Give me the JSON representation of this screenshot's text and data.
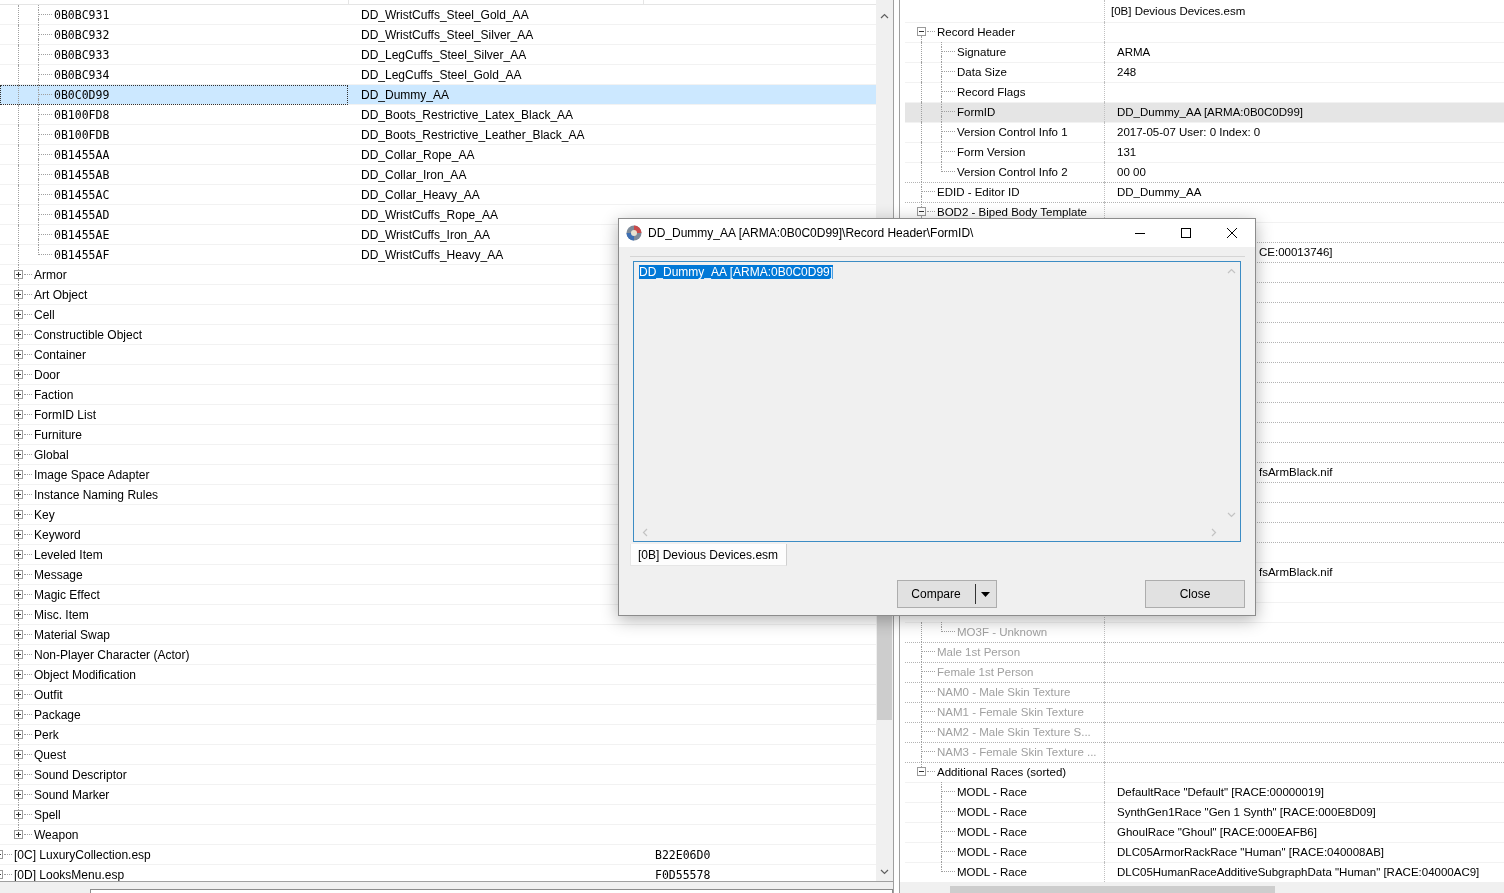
{
  "record_list": {
    "tree": [
      {
        "kind": "continued",
        "children": [
          {
            "kind": "continued",
            "children": [
              {
                "kind": "record",
                "label": "0B0BC931",
                "column_2": "DD_WristCuffs_Steel_Gold_AA",
                "selected": false
              },
              {
                "kind": "record",
                "label": "0B0BC932",
                "column_2": "DD_WristCuffs_Steel_Silver_AA",
                "selected": false
              },
              {
                "kind": "record",
                "label": "0B0BC933",
                "column_2": "DD_LegCuffs_Steel_Silver_AA",
                "selected": false
              },
              {
                "kind": "record",
                "label": "0B0BC934",
                "column_2": "DD_LegCuffs_Steel_Gold_AA",
                "selected": false
              },
              {
                "kind": "record",
                "label": "0B0C0D99",
                "column_2": "DD_Dummy_AA",
                "selected": true
              },
              {
                "kind": "record",
                "label": "0B100FD8",
                "column_2": "DD_Boots_Restrictive_Latex_Black_AA",
                "selected": false
              },
              {
                "kind": "record",
                "label": "0B100FDB",
                "column_2": "DD_Boots_Restrictive_Leather_Black_AA",
                "selected": false
              },
              {
                "kind": "record",
                "label": "0B1455AA",
                "column_2": "DD_Collar_Rope_AA",
                "selected": false
              },
              {
                "kind": "record",
                "label": "0B1455AB",
                "column_2": "DD_Collar_Iron_AA",
                "selected": false
              },
              {
                "kind": "record",
                "label": "0B1455AC",
                "column_2": "DD_Collar_Heavy_AA",
                "selected": false
              },
              {
                "kind": "record",
                "label": "0B1455AD",
                "column_2": "DD_WristCuffs_Rope_AA",
                "selected": false
              },
              {
                "kind": "record",
                "label": "0B1455AE",
                "column_2": "DD_WristCuffs_Iron_AA",
                "selected": false
              },
              {
                "kind": "record",
                "label": "0B1455AF",
                "column_2": "DD_WristCuffs_Heavy_AA",
                "selected": false
              }
            ]
          },
          {
            "kind": "group",
            "label": "Armor",
            "expanded": false,
            "selected": false
          },
          {
            "kind": "group",
            "label": "Art Object",
            "expanded": false,
            "selected": false
          },
          {
            "kind": "group",
            "label": "Cell",
            "expanded": false,
            "selected": false
          },
          {
            "kind": "group",
            "label": "Constructible Object",
            "expanded": false,
            "selected": false
          },
          {
            "kind": "group",
            "label": "Container",
            "expanded": false,
            "selected": false
          },
          {
            "kind": "group",
            "label": "Door",
            "expanded": false,
            "selected": false
          },
          {
            "kind": "group",
            "label": "Faction",
            "expanded": false,
            "selected": false
          },
          {
            "kind": "group",
            "label": "FormID List",
            "expanded": false,
            "selected": false
          },
          {
            "kind": "group",
            "label": "Furniture",
            "expanded": false,
            "selected": false
          },
          {
            "kind": "group",
            "label": "Global",
            "expanded": false,
            "selected": false
          },
          {
            "kind": "group",
            "label": "Image Space Adapter",
            "expanded": false,
            "selected": false
          },
          {
            "kind": "group",
            "label": "Instance Naming Rules",
            "expanded": false,
            "selected": false
          },
          {
            "kind": "group",
            "label": "Key",
            "expanded": false,
            "selected": false
          },
          {
            "kind": "group",
            "label": "Keyword",
            "expanded": false,
            "selected": false
          },
          {
            "kind": "group",
            "label": "Leveled Item",
            "expanded": false,
            "selected": false
          },
          {
            "kind": "group",
            "label": "Message",
            "expanded": false,
            "selected": false
          },
          {
            "kind": "group",
            "label": "Magic Effect",
            "expanded": false,
            "selected": false
          },
          {
            "kind": "group",
            "label": "Misc. Item",
            "expanded": false,
            "selected": false
          },
          {
            "kind": "group",
            "label": "Material Swap",
            "expanded": false,
            "selected": false
          },
          {
            "kind": "group",
            "label": "Non-Player Character (Actor)",
            "expanded": false,
            "selected": false
          },
          {
            "kind": "group",
            "label": "Object Modification",
            "expanded": false,
            "selected": false
          },
          {
            "kind": "group",
            "label": "Outfit",
            "expanded": false,
            "selected": false
          },
          {
            "kind": "group",
            "label": "Package",
            "expanded": false,
            "selected": false
          },
          {
            "kind": "group",
            "label": "Perk",
            "expanded": false,
            "selected": false
          },
          {
            "kind": "group",
            "label": "Quest",
            "expanded": false,
            "selected": false
          },
          {
            "kind": "group",
            "label": "Sound Descriptor",
            "expanded": false,
            "selected": false
          },
          {
            "kind": "group",
            "label": "Sound Marker",
            "expanded": false,
            "selected": false
          },
          {
            "kind": "group",
            "label": "Spell",
            "expanded": false,
            "selected": false
          },
          {
            "kind": "group",
            "label": "Weapon",
            "expanded": false,
            "selected": false
          }
        ]
      },
      {
        "kind": "plugin",
        "label": "[0C] LuxuryCollection.esp",
        "column_3": "B22E06D0",
        "selected": false
      },
      {
        "kind": "plugin",
        "label": "[0D] LooksMenu.esp",
        "column_3": "F0D55578",
        "selected": false
      }
    ]
  },
  "record_view": {
    "column_2_header": "[0B] Devious Devices.esm",
    "tree": [
      {
        "kind": "field",
        "label": "Record Header",
        "expanded": true,
        "selected": false,
        "disabled": false,
        "children": [
          {
            "kind": "field",
            "label": "Signature",
            "value": "ARMA",
            "selected": false,
            "disabled": false
          },
          {
            "kind": "field",
            "label": "Data Size",
            "value": "248",
            "selected": false,
            "disabled": false
          },
          {
            "kind": "field",
            "label": "Record Flags",
            "selected": false,
            "disabled": false
          },
          {
            "kind": "field",
            "label": "FormID",
            "value": "DD_Dummy_AA [ARMA:0B0C0D99]",
            "selected": true,
            "disabled": false
          },
          {
            "kind": "field",
            "label": "Version Control Info 1",
            "value": "2017-05-07 User: 0 Index: 0",
            "selected": false,
            "disabled": false
          },
          {
            "kind": "field",
            "label": "Form Version",
            "value": "131",
            "selected": false,
            "disabled": false
          },
          {
            "kind": "field",
            "label": "Version Control Info 2",
            "value": "00 00",
            "selected": false,
            "disabled": false
          }
        ]
      },
      {
        "kind": "field",
        "label": "EDID - Editor ID",
        "value": "DD_Dummy_AA",
        "selected": false,
        "disabled": false
      },
      {
        "kind": "field",
        "label": "BOD2 - Biped Body Template",
        "expanded": true,
        "selected": false,
        "disabled": false,
        "children": [
          {
            "kind": "covered"
          }
        ]
      },
      {
        "kind": "covered",
        "value": "CE:00013746]"
      },
      {
        "kind": "covered"
      },
      {
        "kind": "covered"
      },
      {
        "kind": "covered"
      },
      {
        "kind": "covered"
      },
      {
        "kind": "covered"
      },
      {
        "kind": "covered"
      },
      {
        "kind": "covered"
      },
      {
        "kind": "covered"
      },
      {
        "kind": "covered"
      },
      {
        "kind": "covered"
      },
      {
        "kind": "covered",
        "value": "fsArmBlack.nif"
      },
      {
        "kind": "covered"
      },
      {
        "kind": "covered"
      },
      {
        "kind": "covered"
      },
      {
        "kind": "covered",
        "children": [
          {
            "kind": "covered",
            "value": "fsArmBlack.nif"
          },
          {
            "kind": "covered"
          },
          {
            "kind": "covered"
          },
          {
            "kind": "field",
            "label": "MO3F - Unknown",
            "selected": false,
            "disabled": true
          }
        ]
      },
      {
        "kind": "field",
        "label": "Male 1st Person",
        "selected": false,
        "disabled": true
      },
      {
        "kind": "field",
        "label": "Female 1st Person",
        "selected": false,
        "disabled": true
      },
      {
        "kind": "field",
        "label": "NAM0 - Male Skin Texture",
        "selected": false,
        "disabled": true
      },
      {
        "kind": "field",
        "label": "NAM1 - Female Skin Texture",
        "selected": false,
        "disabled": true
      },
      {
        "kind": "field",
        "label": "NAM2 - Male Skin Texture S...",
        "selected": false,
        "disabled": true
      },
      {
        "kind": "field",
        "label": "NAM3 - Female Skin Texture ...",
        "selected": false,
        "disabled": true
      },
      {
        "kind": "field",
        "label": "Additional Races (sorted)",
        "expanded": true,
        "selected": false,
        "disabled": false,
        "children": [
          {
            "kind": "field",
            "label": "MODL - Race",
            "value": "DefaultRace \"Default\" [RACE:00000019]",
            "selected": false,
            "disabled": false
          },
          {
            "kind": "field",
            "label": "MODL - Race",
            "value": "SynthGen1Race \"Gen 1 Synth\" [RACE:000E8D09]",
            "selected": false,
            "disabled": false
          },
          {
            "kind": "field",
            "label": "MODL - Race",
            "value": "GhoulRace \"Ghoul\" [RACE:000EAFB6]",
            "selected": false,
            "disabled": false
          },
          {
            "kind": "field",
            "label": "MODL - Race",
            "value": "DLC05ArmorRackRace \"Human\" [RACE:040008AB]",
            "selected": false,
            "disabled": false
          },
          {
            "kind": "field",
            "label": "MODL - Race",
            "value": "DLC05HumanRaceAdditiveSubgraphData \"Human\" [RACE:04000AC9]",
            "selected": false,
            "disabled": false
          }
        ]
      }
    ]
  },
  "dialog": {
    "title": "DD_Dummy_AA [ARMA:0B0C0D99]\\Record Header\\FormID\\",
    "text": "DD_Dummy_AA [ARMA:0B0C0D99]",
    "text_selected": true,
    "tabs": [
      {
        "label": "[0B] Devious Devices.esm",
        "selected": true
      }
    ],
    "buttons": [
      {
        "kind": "split",
        "label": "Compare"
      },
      {
        "kind": "plain",
        "label": "Close"
      }
    ]
  }
}
